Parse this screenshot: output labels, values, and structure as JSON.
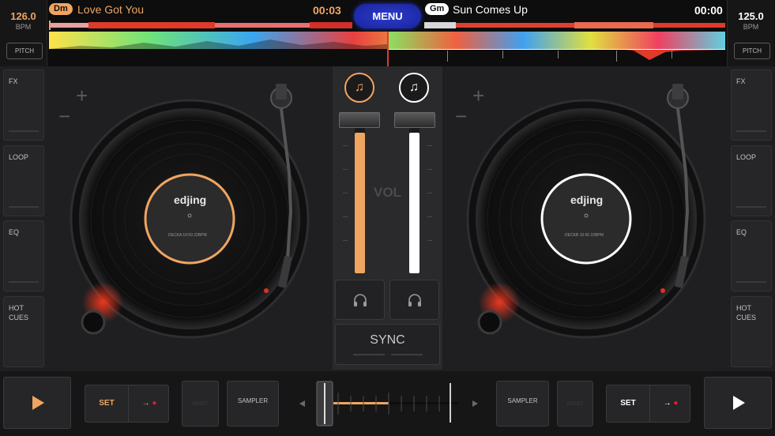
{
  "colors": {
    "deck_a": "#f0a560",
    "deck_b": "#ffffff",
    "menu": "#2534b0",
    "record_glow": "#e03020"
  },
  "deck_a": {
    "bpm": "126.0",
    "bpm_unit": "BPM",
    "pitch_label": "PITCH",
    "key": "Dm",
    "title": "Love Got You",
    "time": "00:03",
    "label_brand": "edjing",
    "label_caption": "DECKA 10:50 22BPM",
    "volume_level": 0.92
  },
  "deck_b": {
    "bpm": "125.0",
    "bpm_unit": "BPM",
    "pitch_label": "PITCH",
    "key": "Gm",
    "title": "Sun Comes Up",
    "time": "00:00",
    "label_brand": "edjing",
    "label_caption": "DECKB 10:50 22BPM",
    "volume_level": 0.92
  },
  "menu_label": "MENU",
  "left_panel": [
    "FX",
    "LOOP",
    "EQ",
    "HOT\nCUES"
  ],
  "right_panel": [
    "FX",
    "LOOP",
    "EQ",
    "HOT\nCUES"
  ],
  "mixer": {
    "vol_label": "VOL",
    "sync_label": "SYNC",
    "headphone_icon": "headphones-icon",
    "track_icon": "music-note-icon"
  },
  "bottom": {
    "set_label": "SET",
    "arrow": "→",
    "reset_label": "RESET",
    "sampler_label": "SAMPLER",
    "crossfader_position": 0.0
  },
  "icons": {
    "plus": "+",
    "minus": "−"
  }
}
